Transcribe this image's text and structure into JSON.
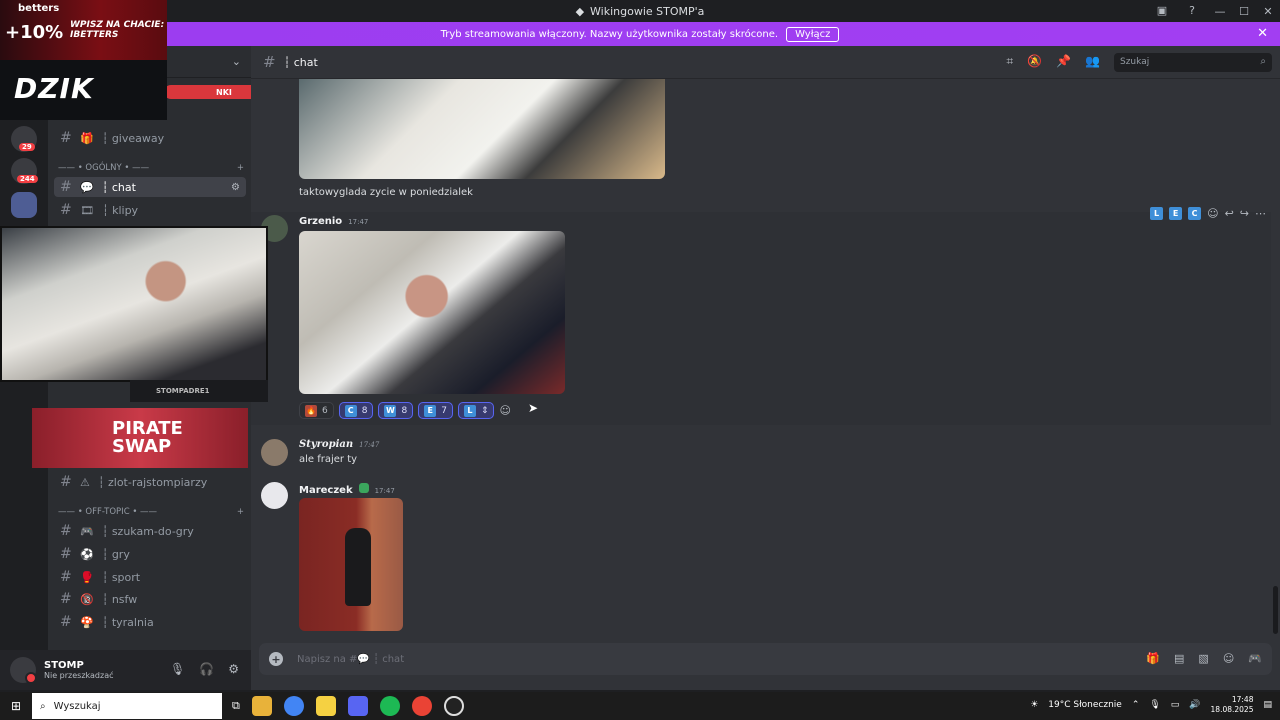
{
  "window": {
    "title": "Wikingowie STOMP'a"
  },
  "banner": {
    "text": "Tryb streamowania włączony. Nazwy użytkownika zostały skrócone.",
    "button": "Wyłącz"
  },
  "sidebar": {
    "pill_label": "NKI",
    "channels": [
      {
        "name": "┆ giveaway",
        "emoji": "🎁"
      },
      {
        "name": "┆ chat",
        "emoji": "💬",
        "active": true
      },
      {
        "name": "┆ klipy",
        "emoji": "🎞"
      },
      {
        "name": "┆ zlot-rajstompiarzy",
        "emoji": "⚠"
      },
      {
        "name": "┆ szukam-do-gry",
        "emoji": "🎮"
      },
      {
        "name": "┆ gry",
        "emoji": "⚽"
      },
      {
        "name": "┆ sport",
        "emoji": "🥊"
      },
      {
        "name": "┆ nsfw",
        "emoji": "🔞"
      },
      {
        "name": "┆ tyralnia",
        "emoji": "🍄"
      }
    ],
    "categories": [
      "—— • OGÓLNY • ——",
      "—— • OFF-TOPIC • ——"
    ],
    "server_badges": [
      "29",
      "244"
    ]
  },
  "user": {
    "name": "STOMP",
    "status": "Nie przeszkadzać"
  },
  "channel_header": {
    "name": "┆ chat",
    "search_placeholder": "Szukaj"
  },
  "messages": [
    {
      "text": "taktowyglada zycie w poniedzialek"
    },
    {
      "author": "Grzenio",
      "time": "17:47"
    },
    {
      "author": "Styropian",
      "time": "17:47",
      "text": "ale frajer ty"
    },
    {
      "author": "Mareczek",
      "time": "17:47"
    }
  ],
  "reactions": [
    {
      "e": "🔥",
      "count": "6"
    },
    {
      "e": "C",
      "count": "8"
    },
    {
      "e": "W",
      "count": "8"
    },
    {
      "e": "E",
      "count": "7"
    },
    {
      "e": "L",
      "count": ""
    }
  ],
  "hover_badges": [
    "L",
    "E",
    "C"
  ],
  "composer": {
    "placeholder": "Napisz na #💬 ┆ chat"
  },
  "overlay": {
    "brand1": "betters",
    "brand1_promo": "+10%",
    "brand1_code": "WPISZ NA CHACIE: IBETTERS",
    "brand2": "DZIK",
    "camtag": "STOMPADRE1",
    "brand3": "PIRATE SWAP"
  },
  "taskbar": {
    "search": "Wyszukaj",
    "weather": "19°C Słonecznie",
    "time": "17:48",
    "date": "18.08.2025"
  }
}
